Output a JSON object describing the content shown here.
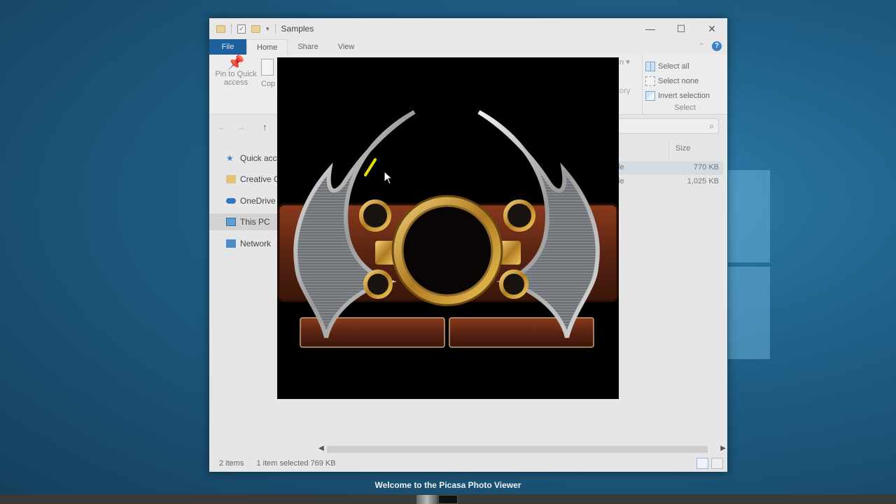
{
  "explorer": {
    "title": "Samples",
    "tabs": [
      "File",
      "Home",
      "Share",
      "View"
    ],
    "pin_label": "Pin to Quick access",
    "copy_label_fragment": "Cop",
    "open_fragment": "en",
    "history_fragment": "tory",
    "select_group": {
      "items": [
        "Select all",
        "Select none",
        "Invert selection"
      ],
      "label": "Select"
    },
    "nav": [
      "Quick acce",
      "Creative Cl",
      "OneDrive",
      "This PC",
      "Network"
    ],
    "columns": {
      "size": "Size"
    },
    "files": [
      {
        "type_fragment": "le",
        "size": "770 KB",
        "selected": true
      },
      {
        "type_fragment": "le",
        "size": "1,025 KB",
        "selected": false
      }
    ],
    "status": {
      "count": "2 items",
      "selection": "1 item selected  769 KB"
    }
  },
  "viewer": {
    "caption": "Welcome to the Picasa Photo Viewer"
  },
  "icons": [
    "folder-icon",
    "properties-icon",
    "pin-icon",
    "search-icon",
    "help-icon",
    "minimize-icon",
    "maximize-icon",
    "close-icon",
    "mouse-cursor-icon"
  ]
}
